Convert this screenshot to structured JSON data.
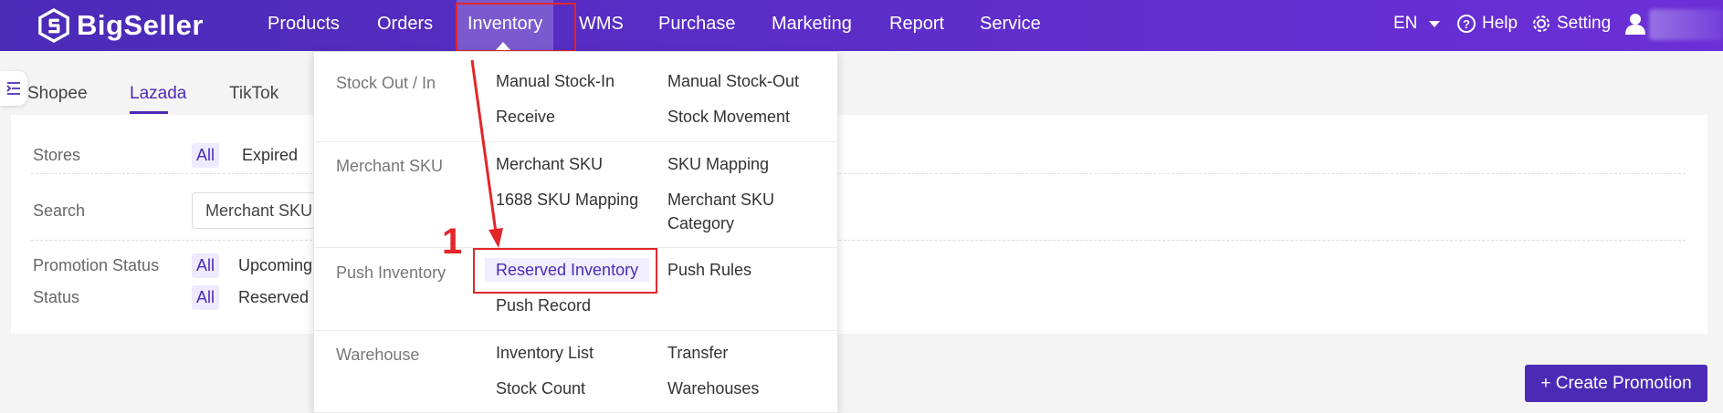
{
  "brand": {
    "name": "BigSeller"
  },
  "nav": {
    "products": "Products",
    "orders": "Orders",
    "inventory": "Inventory",
    "wms": "WMS",
    "purchase": "Purchase",
    "marketing": "Marketing",
    "report": "Report",
    "service": "Service",
    "lang": "EN",
    "help": "Help",
    "setting": "Setting"
  },
  "tabs": [
    "Shopee",
    "Lazada",
    "TikTok"
  ],
  "active_tab": "Lazada",
  "filters": {
    "stores_label": "Stores",
    "stores_all": "All",
    "stores_expired": "Expired",
    "search_label": "Search",
    "search_value": "Merchant SKU",
    "promotion_status_label": "Promotion Status",
    "promotion_all": "All",
    "promotion_upcoming": "Upcoming",
    "status_label": "Status",
    "status_all": "All",
    "status_reserved": "Reserved"
  },
  "create_button": {
    "icon": "plus-icon",
    "label": "+ Create Promotion"
  },
  "dropdown": {
    "groups": [
      {
        "name": "Stock Out / In",
        "items": [
          "Manual Stock-In",
          "Manual Stock-Out",
          "Receive",
          "Stock Movement"
        ]
      },
      {
        "name": "Merchant SKU",
        "items": [
          "Merchant SKU",
          "SKU Mapping",
          "1688 SKU Mapping",
          "Merchant SKU Category"
        ]
      },
      {
        "name": "Push Inventory",
        "items": [
          "Reserved Inventory",
          "Push Rules",
          "Push Record"
        ]
      },
      {
        "name": "Warehouse",
        "items": [
          "Inventory List",
          "Transfer",
          "Stock Count",
          "Warehouses"
        ]
      }
    ],
    "highlighted_item": "Reserved Inventory"
  },
  "annotation": {
    "number": "1",
    "color": "#e2262a"
  },
  "colors": {
    "brand": "#4b2bb5",
    "topbar_start": "#4a2bb6",
    "topbar_end": "#6b2fd6"
  }
}
